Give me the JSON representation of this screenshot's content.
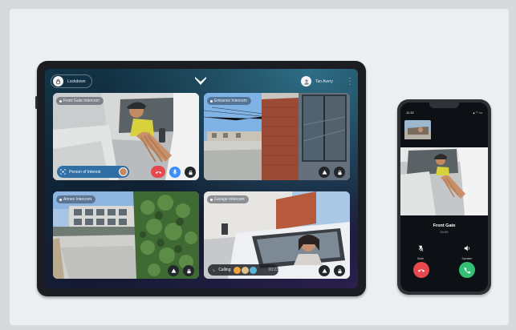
{
  "tablet": {
    "lockdown_label": "Lockdown",
    "user_label": "Tan Avery",
    "tiles": [
      {
        "label": "Front Gate Intercom",
        "poi_label": "Person of Interest"
      },
      {
        "label": "Entrance Intercom"
      },
      {
        "label": "Annex Intercom"
      },
      {
        "label": "Garage Intercom",
        "calling_label": "Calling",
        "timer": "00:23"
      }
    ]
  },
  "phone": {
    "time": "11:32",
    "caller_name": "Front Gate",
    "call_duration": "00:05",
    "mute_label": "Mute",
    "speaker_label": "Speaker"
  },
  "colors": {
    "decline_red": "#e5484d",
    "accept_green": "#34c074",
    "mic_blue": "#3a8ef6",
    "poi_pill": "#2f6fa5"
  }
}
